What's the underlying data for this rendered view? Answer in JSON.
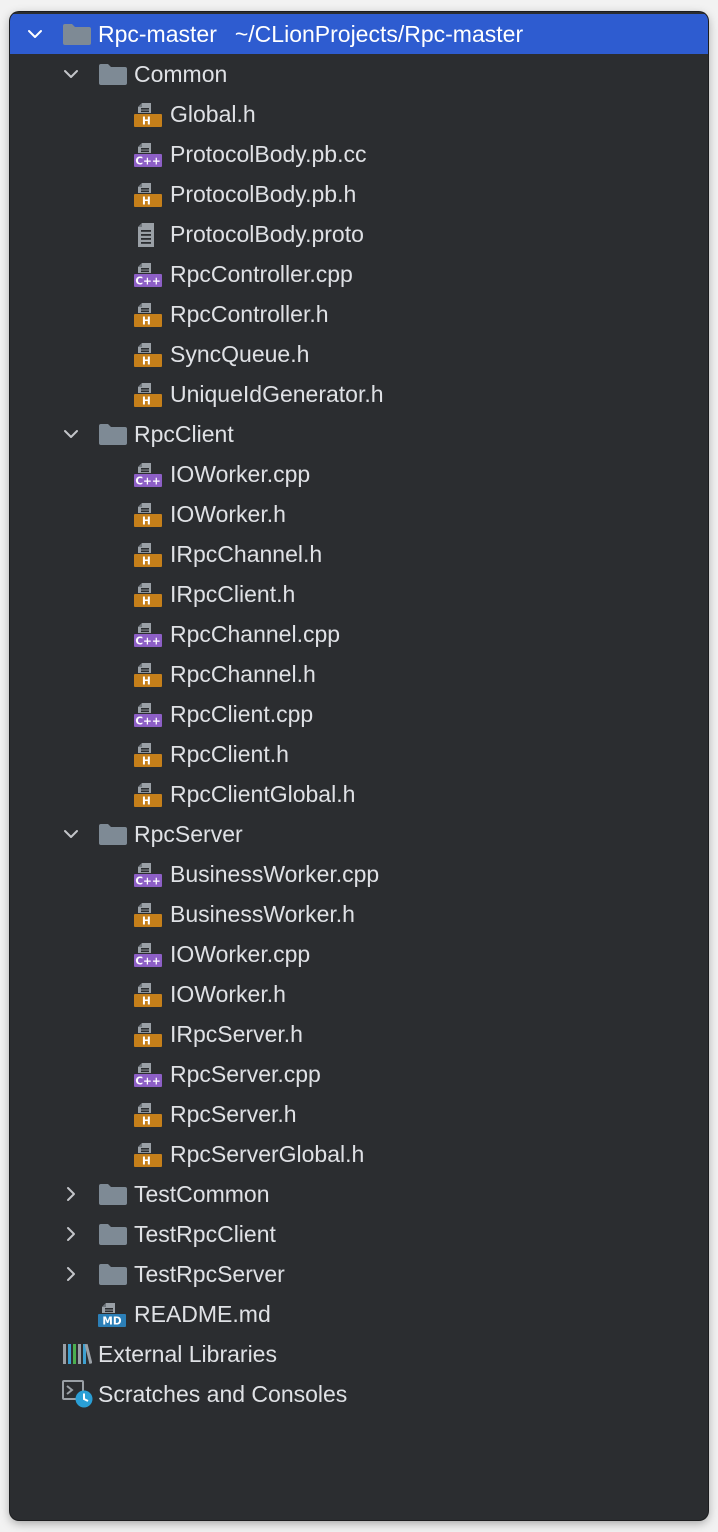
{
  "colors": {
    "background": "#2b2d30",
    "selection": "#2e5cd0",
    "text": "#dfe1e5",
    "folder": "#7e8a95",
    "header_badge": "#c57f1a",
    "cpp_badge": "#8d5fc6",
    "md_badge": "#2c7fb7"
  },
  "tree": [
    {
      "label": "Rpc-master",
      "path": "~/CLionProjects/Rpc-master",
      "depth": 0,
      "kind": "folder",
      "expanded": true,
      "selected": true
    },
    {
      "label": "Common",
      "depth": 1,
      "kind": "folder",
      "expanded": true
    },
    {
      "label": "Global.h",
      "depth": 2,
      "kind": "h"
    },
    {
      "label": "ProtocolBody.pb.cc",
      "depth": 2,
      "kind": "cpp"
    },
    {
      "label": "ProtocolBody.pb.h",
      "depth": 2,
      "kind": "h"
    },
    {
      "label": "ProtocolBody.proto",
      "depth": 2,
      "kind": "text"
    },
    {
      "label": "RpcController.cpp",
      "depth": 2,
      "kind": "cpp"
    },
    {
      "label": "RpcController.h",
      "depth": 2,
      "kind": "h"
    },
    {
      "label": "SyncQueue.h",
      "depth": 2,
      "kind": "h"
    },
    {
      "label": "UniqueIdGenerator.h",
      "depth": 2,
      "kind": "h"
    },
    {
      "label": "RpcClient",
      "depth": 1,
      "kind": "folder",
      "expanded": true
    },
    {
      "label": "IOWorker.cpp",
      "depth": 2,
      "kind": "cpp"
    },
    {
      "label": "IOWorker.h",
      "depth": 2,
      "kind": "h"
    },
    {
      "label": "IRpcChannel.h",
      "depth": 2,
      "kind": "h"
    },
    {
      "label": "IRpcClient.h",
      "depth": 2,
      "kind": "h"
    },
    {
      "label": "RpcChannel.cpp",
      "depth": 2,
      "kind": "cpp"
    },
    {
      "label": "RpcChannel.h",
      "depth": 2,
      "kind": "h"
    },
    {
      "label": "RpcClient.cpp",
      "depth": 2,
      "kind": "cpp"
    },
    {
      "label": "RpcClient.h",
      "depth": 2,
      "kind": "h"
    },
    {
      "label": "RpcClientGlobal.h",
      "depth": 2,
      "kind": "h"
    },
    {
      "label": "RpcServer",
      "depth": 1,
      "kind": "folder",
      "expanded": true
    },
    {
      "label": "BusinessWorker.cpp",
      "depth": 2,
      "kind": "cpp"
    },
    {
      "label": "BusinessWorker.h",
      "depth": 2,
      "kind": "h"
    },
    {
      "label": "IOWorker.cpp",
      "depth": 2,
      "kind": "cpp"
    },
    {
      "label": "IOWorker.h",
      "depth": 2,
      "kind": "h"
    },
    {
      "label": "IRpcServer.h",
      "depth": 2,
      "kind": "h"
    },
    {
      "label": "RpcServer.cpp",
      "depth": 2,
      "kind": "cpp"
    },
    {
      "label": "RpcServer.h",
      "depth": 2,
      "kind": "h"
    },
    {
      "label": "RpcServerGlobal.h",
      "depth": 2,
      "kind": "h"
    },
    {
      "label": "TestCommon",
      "depth": 1,
      "kind": "folder",
      "expanded": false
    },
    {
      "label": "TestRpcClient",
      "depth": 1,
      "kind": "folder",
      "expanded": false
    },
    {
      "label": "TestRpcServer",
      "depth": 1,
      "kind": "folder",
      "expanded": false
    },
    {
      "label": "README.md",
      "depth": 1,
      "kind": "md"
    },
    {
      "label": "External Libraries",
      "depth": 0,
      "kind": "libraries"
    },
    {
      "label": "Scratches and Consoles",
      "depth": 0,
      "kind": "scratches"
    }
  ],
  "badges": {
    "h": "H",
    "cpp": "C++",
    "md": "MD"
  }
}
